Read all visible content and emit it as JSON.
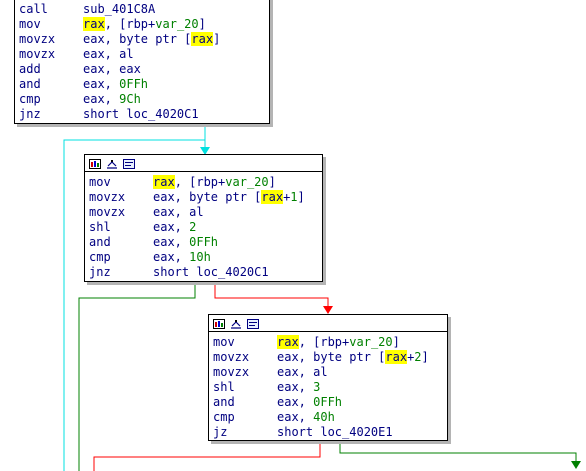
{
  "blocks": [
    {
      "id": "block-1",
      "header": false,
      "lines": [
        {
          "mnemonic": "call",
          "operands": [
            {
              "t": "sub_401C8A"
            }
          ]
        },
        {
          "mnemonic": "mov",
          "operands": [
            {
              "t": "rax",
              "hl": true
            },
            {
              "t": ", [rbp+"
            },
            {
              "t": "var_20",
              "c": "var"
            },
            {
              "t": "]"
            }
          ]
        },
        {
          "mnemonic": "movzx",
          "operands": [
            {
              "t": "eax, byte ptr ["
            },
            {
              "t": "rax",
              "hl": true
            },
            {
              "t": "]"
            }
          ]
        },
        {
          "mnemonic": "movzx",
          "operands": [
            {
              "t": "eax, al"
            }
          ]
        },
        {
          "mnemonic": "add",
          "operands": [
            {
              "t": "eax, eax"
            }
          ]
        },
        {
          "mnemonic": "and",
          "operands": [
            {
              "t": "eax, "
            },
            {
              "t": "0FFh",
              "c": "num"
            }
          ]
        },
        {
          "mnemonic": "cmp",
          "operands": [
            {
              "t": "eax, "
            },
            {
              "t": "9Ch",
              "c": "num"
            }
          ]
        },
        {
          "mnemonic": "jnz",
          "operands": [
            {
              "t": "short loc_4020C1"
            }
          ]
        }
      ]
    },
    {
      "id": "block-2",
      "header": true,
      "lines": [
        {
          "mnemonic": "mov",
          "operands": [
            {
              "t": "rax",
              "hl": true
            },
            {
              "t": ", [rbp+"
            },
            {
              "t": "var_20",
              "c": "var"
            },
            {
              "t": "]"
            }
          ]
        },
        {
          "mnemonic": "movzx",
          "operands": [
            {
              "t": "eax, byte ptr ["
            },
            {
              "t": "rax",
              "hl": true
            },
            {
              "t": "+"
            },
            {
              "t": "1",
              "c": "num"
            },
            {
              "t": "]"
            }
          ]
        },
        {
          "mnemonic": "movzx",
          "operands": [
            {
              "t": "eax, al"
            }
          ]
        },
        {
          "mnemonic": "shl",
          "operands": [
            {
              "t": "eax, "
            },
            {
              "t": "2",
              "c": "num"
            }
          ]
        },
        {
          "mnemonic": "and",
          "operands": [
            {
              "t": "eax, "
            },
            {
              "t": "0FFh",
              "c": "num"
            }
          ]
        },
        {
          "mnemonic": "cmp",
          "operands": [
            {
              "t": "eax, "
            },
            {
              "t": "10h",
              "c": "num"
            }
          ]
        },
        {
          "mnemonic": "jnz",
          "operands": [
            {
              "t": "short loc_4020C1"
            }
          ]
        }
      ]
    },
    {
      "id": "block-3",
      "header": true,
      "lines": [
        {
          "mnemonic": "mov",
          "operands": [
            {
              "t": "rax",
              "hl": true
            },
            {
              "t": ", [rbp+"
            },
            {
              "t": "var_20",
              "c": "var"
            },
            {
              "t": "]"
            }
          ]
        },
        {
          "mnemonic": "movzx",
          "operands": [
            {
              "t": "eax, byte ptr ["
            },
            {
              "t": "rax",
              "hl": true
            },
            {
              "t": "+"
            },
            {
              "t": "2",
              "c": "num"
            },
            {
              "t": "]"
            }
          ]
        },
        {
          "mnemonic": "movzx",
          "operands": [
            {
              "t": "eax, al"
            }
          ]
        },
        {
          "mnemonic": "shl",
          "operands": [
            {
              "t": "eax, "
            },
            {
              "t": "3",
              "c": "num"
            }
          ]
        },
        {
          "mnemonic": "and",
          "operands": [
            {
              "t": "eax, "
            },
            {
              "t": "0FFh",
              "c": "num"
            }
          ]
        },
        {
          "mnemonic": "cmp",
          "operands": [
            {
              "t": "eax, "
            },
            {
              "t": "40h",
              "c": "num"
            }
          ]
        },
        {
          "mnemonic": "jz",
          "operands": [
            {
              "t": "short loc_4020E1"
            }
          ]
        }
      ]
    }
  ],
  "header_icons": [
    "graph-color-icon",
    "graph-edit-icon",
    "graph-text-icon"
  ],
  "colors": {
    "highlight": "#ffff00",
    "code_text": "#000080",
    "number_text": "#008000",
    "edge_unconditional": "#00e0e0",
    "edge_true": "#008000",
    "edge_false": "#ff0000",
    "block_border": "#000000",
    "block_shadow": "#b4b4b4"
  }
}
